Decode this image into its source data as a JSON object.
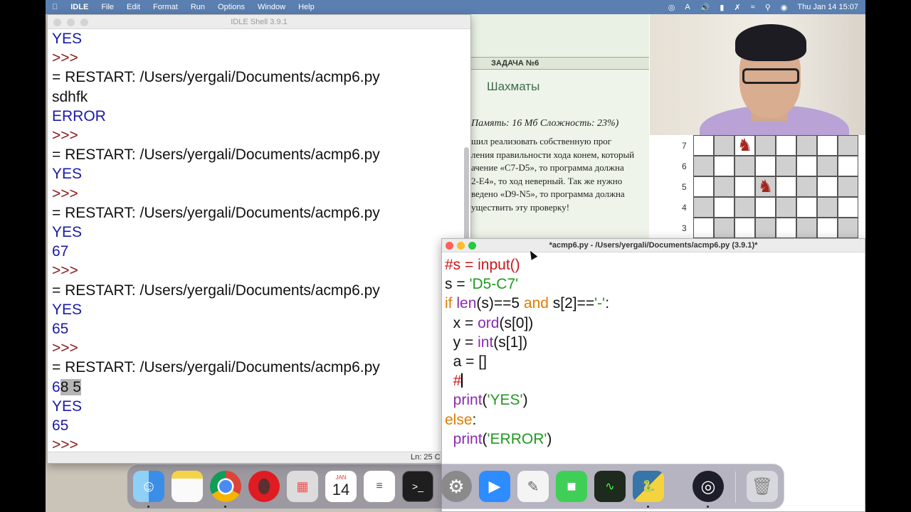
{
  "menubar": {
    "app_name": "IDLE",
    "items": [
      "File",
      "Edit",
      "Format",
      "Run",
      "Options",
      "Window",
      "Help"
    ],
    "clock": "Thu Jan 14  15:07"
  },
  "task_page": {
    "band": "ЗАДАЧА №6",
    "title": "Шахматы",
    "meta": "Память: 16 Мб Сложность: 23%)",
    "paragraph": [
      "шил реализовать собственную прог",
      "ления правильности хода конем, который",
      "ачение «C7-D5», то программа должна",
      "2-E4», то ход неверный. Так же нужно",
      "ведено «D9-N5», то программа должна",
      "уществить эту проверку!"
    ],
    "ranks": [
      "7",
      "6",
      "5",
      "4",
      "3"
    ]
  },
  "shell": {
    "title": "IDLE Shell 3.9.1",
    "lines": [
      {
        "text": "YES",
        "kind": "out"
      },
      {
        "text": ">>>",
        "kind": "prompt"
      },
      {
        "text": "= RESTART: /Users/yergali/Documents/acmp6.py",
        "kind": "text"
      },
      {
        "text": "sdhfk",
        "kind": "text"
      },
      {
        "text": "ERROR",
        "kind": "out"
      },
      {
        "text": ">>>",
        "kind": "prompt"
      },
      {
        "text": "= RESTART: /Users/yergali/Documents/acmp6.py",
        "kind": "text"
      },
      {
        "text": "YES",
        "kind": "out"
      },
      {
        "text": ">>>",
        "kind": "prompt"
      },
      {
        "text": "= RESTART: /Users/yergali/Documents/acmp6.py",
        "kind": "text"
      },
      {
        "text": "YES",
        "kind": "out"
      },
      {
        "text": "67",
        "kind": "out"
      },
      {
        "text": ">>>",
        "kind": "prompt"
      },
      {
        "text": "= RESTART: /Users/yergali/Documents/acmp6.py",
        "kind": "text"
      },
      {
        "text": "YES",
        "kind": "out"
      },
      {
        "text": "65",
        "kind": "out"
      },
      {
        "text": ">>>",
        "kind": "prompt"
      },
      {
        "text": "= RESTART: /Users/yergali/Documents/acmp6.py",
        "kind": "text"
      },
      {
        "text": "",
        "kind": "selected-line"
      },
      {
        "text": "YES",
        "kind": "out"
      },
      {
        "text": "65",
        "kind": "out"
      },
      {
        "text": ">>>",
        "kind": "prompt"
      }
    ],
    "selected_line": {
      "prefix": "6",
      "selection": "8 5"
    },
    "status": "Ln: 25  C"
  },
  "editor": {
    "title": "*acmp6.py - /Users/yergali/Documents/acmp6.py (3.9.1)*"
  },
  "dock": {
    "apps": [
      "Finder",
      "Notes",
      "Chrome",
      "Opera",
      "Launchpad",
      "Calendar",
      "Reminders",
      "Terminal",
      "System Preferences",
      "Zoom",
      "TextEdit",
      "FaceTime",
      "Activity Monitor",
      "Python Launcher",
      "OBS",
      "Trash"
    ],
    "calendar_month": "JAN",
    "calendar_day": "14"
  }
}
